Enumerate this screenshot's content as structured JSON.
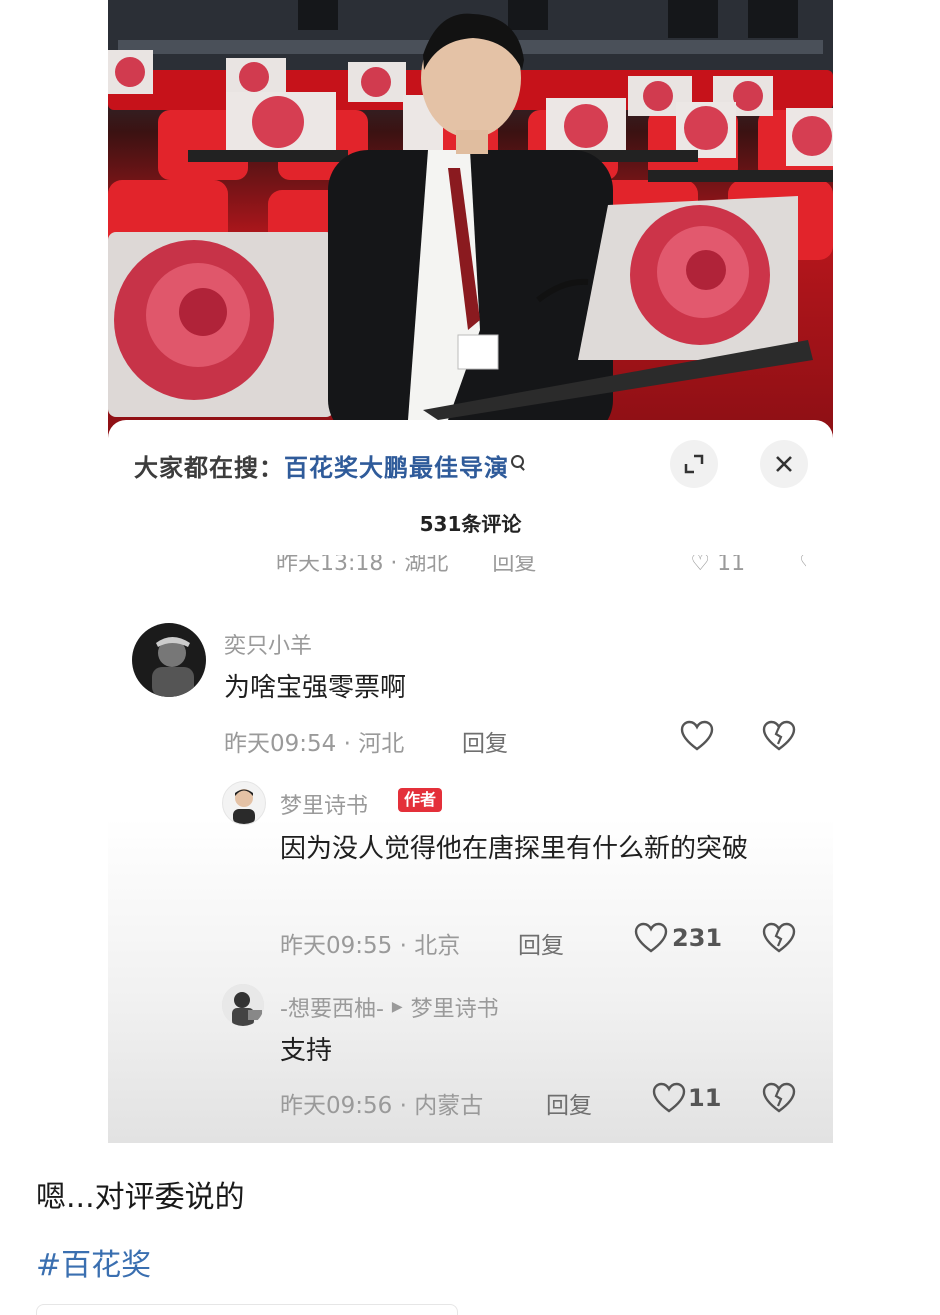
{
  "search_bar": {
    "prefix": "大家都在搜：",
    "term": "百花奖大鹏最佳导演"
  },
  "comments_header": {
    "count_title": "531条评论"
  },
  "previous_comment_fragment": {
    "meta": "昨天13:18 · 湖北",
    "reply_label": "回复",
    "like_count": "11"
  },
  "comments": [
    {
      "username": "奕只小羊",
      "text": "为啥宝强零票啊",
      "meta": "昨天09:54 · 河北",
      "reply_label": "回复",
      "like_count": ""
    },
    {
      "username": "梦里诗书",
      "badge": "作者",
      "text": "因为没人觉得他在唐探里有什么新的突破",
      "meta": "昨天09:55 · 北京",
      "reply_label": "回复",
      "like_count": "231"
    },
    {
      "username": "-想要西柚-",
      "reply_to": "梦里诗书",
      "text": "支持",
      "meta": "昨天09:56 · 内蒙古",
      "reply_label": "回复",
      "like_count": "11"
    }
  ],
  "post": {
    "caption": "嗯...对评委说的",
    "hashtag": "#百花奖"
  },
  "colors": {
    "link_blue": "#2f5b9a",
    "hashtag_blue": "#3a6fb0",
    "author_badge_red": "#e4303a",
    "seat_red": "#b5161c"
  },
  "icons": {
    "search": "search-icon",
    "expand": "expand-icon",
    "close": "close-icon",
    "like": "heart-icon",
    "dislike": "broken-heart-icon",
    "reply_arrow": "play-arrow-icon"
  }
}
